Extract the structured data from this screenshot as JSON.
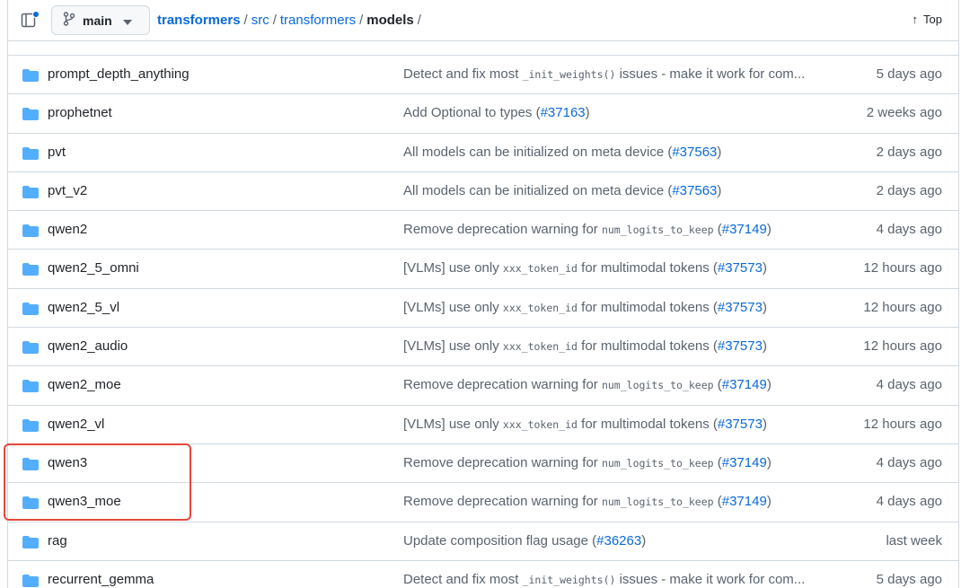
{
  "header": {
    "branch": "main",
    "breadcrumb": [
      "transformers",
      "src",
      "transformers",
      "models"
    ],
    "separator": "/",
    "top_label": "Top"
  },
  "rows": [
    {
      "name": "prompt_depth_anything",
      "msg_parts": [
        {
          "t": "Detect and fix most "
        },
        {
          "code": "_init_weights()"
        },
        {
          "t": " issues - make it work for com..."
        }
      ],
      "date": "5 days ago"
    },
    {
      "name": "prophetnet",
      "msg_parts": [
        {
          "t": "Add Optional to types ("
        },
        {
          "pr": "#37163"
        },
        {
          "t": ")"
        }
      ],
      "date": "2 weeks ago"
    },
    {
      "name": "pvt",
      "msg_parts": [
        {
          "t": "All models can be initialized on meta device ("
        },
        {
          "pr": "#37563"
        },
        {
          "t": ")"
        }
      ],
      "date": "2 days ago"
    },
    {
      "name": "pvt_v2",
      "msg_parts": [
        {
          "t": "All models can be initialized on meta device ("
        },
        {
          "pr": "#37563"
        },
        {
          "t": ")"
        }
      ],
      "date": "2 days ago"
    },
    {
      "name": "qwen2",
      "msg_parts": [
        {
          "t": "Remove deprecation warning for "
        },
        {
          "code": "num_logits_to_keep"
        },
        {
          "t": " ("
        },
        {
          "pr": "#37149"
        },
        {
          "t": ")"
        }
      ],
      "date": "4 days ago"
    },
    {
      "name": "qwen2_5_omni",
      "msg_parts": [
        {
          "t": "[VLMs] use only "
        },
        {
          "code": "xxx_token_id"
        },
        {
          "t": " for multimodal tokens ("
        },
        {
          "pr": "#37573"
        },
        {
          "t": ")"
        }
      ],
      "date": "12 hours ago"
    },
    {
      "name": "qwen2_5_vl",
      "msg_parts": [
        {
          "t": "[VLMs] use only "
        },
        {
          "code": "xxx_token_id"
        },
        {
          "t": " for multimodal tokens ("
        },
        {
          "pr": "#37573"
        },
        {
          "t": ")"
        }
      ],
      "date": "12 hours ago"
    },
    {
      "name": "qwen2_audio",
      "msg_parts": [
        {
          "t": "[VLMs] use only "
        },
        {
          "code": "xxx_token_id"
        },
        {
          "t": " for multimodal tokens ("
        },
        {
          "pr": "#37573"
        },
        {
          "t": ")"
        }
      ],
      "date": "12 hours ago"
    },
    {
      "name": "qwen2_moe",
      "msg_parts": [
        {
          "t": "Remove deprecation warning for "
        },
        {
          "code": "num_logits_to_keep"
        },
        {
          "t": " ("
        },
        {
          "pr": "#37149"
        },
        {
          "t": ")"
        }
      ],
      "date": "4 days ago"
    },
    {
      "name": "qwen2_vl",
      "msg_parts": [
        {
          "t": "[VLMs] use only "
        },
        {
          "code": "xxx_token_id"
        },
        {
          "t": " for multimodal tokens ("
        },
        {
          "pr": "#37573"
        },
        {
          "t": ")"
        }
      ],
      "date": "12 hours ago"
    },
    {
      "name": "qwen3",
      "msg_parts": [
        {
          "t": "Remove deprecation warning for "
        },
        {
          "code": "num_logits_to_keep"
        },
        {
          "t": " ("
        },
        {
          "pr": "#37149"
        },
        {
          "t": ")"
        }
      ],
      "date": "4 days ago"
    },
    {
      "name": "qwen3_moe",
      "msg_parts": [
        {
          "t": "Remove deprecation warning for "
        },
        {
          "code": "num_logits_to_keep"
        },
        {
          "t": " ("
        },
        {
          "pr": "#37149"
        },
        {
          "t": ")"
        }
      ],
      "date": "4 days ago"
    },
    {
      "name": "rag",
      "msg_parts": [
        {
          "t": "Update composition flag usage ("
        },
        {
          "pr": "#36263"
        },
        {
          "t": ")"
        }
      ],
      "date": "last week"
    },
    {
      "name": "recurrent_gemma",
      "msg_parts": [
        {
          "t": "Detect and fix most "
        },
        {
          "code": "_init_weights()"
        },
        {
          "t": " issues - make it work for com..."
        }
      ],
      "date": "5 days ago"
    }
  ],
  "colors": {
    "folder": "#54aeff",
    "link": "#0969da",
    "highlight": "#e5483c"
  },
  "icons": {
    "panel": "side-panel-icon",
    "branch": "git-branch-icon",
    "caret": "triangle-down-icon",
    "top": "arrow-up-icon",
    "folder": "folder-icon"
  }
}
